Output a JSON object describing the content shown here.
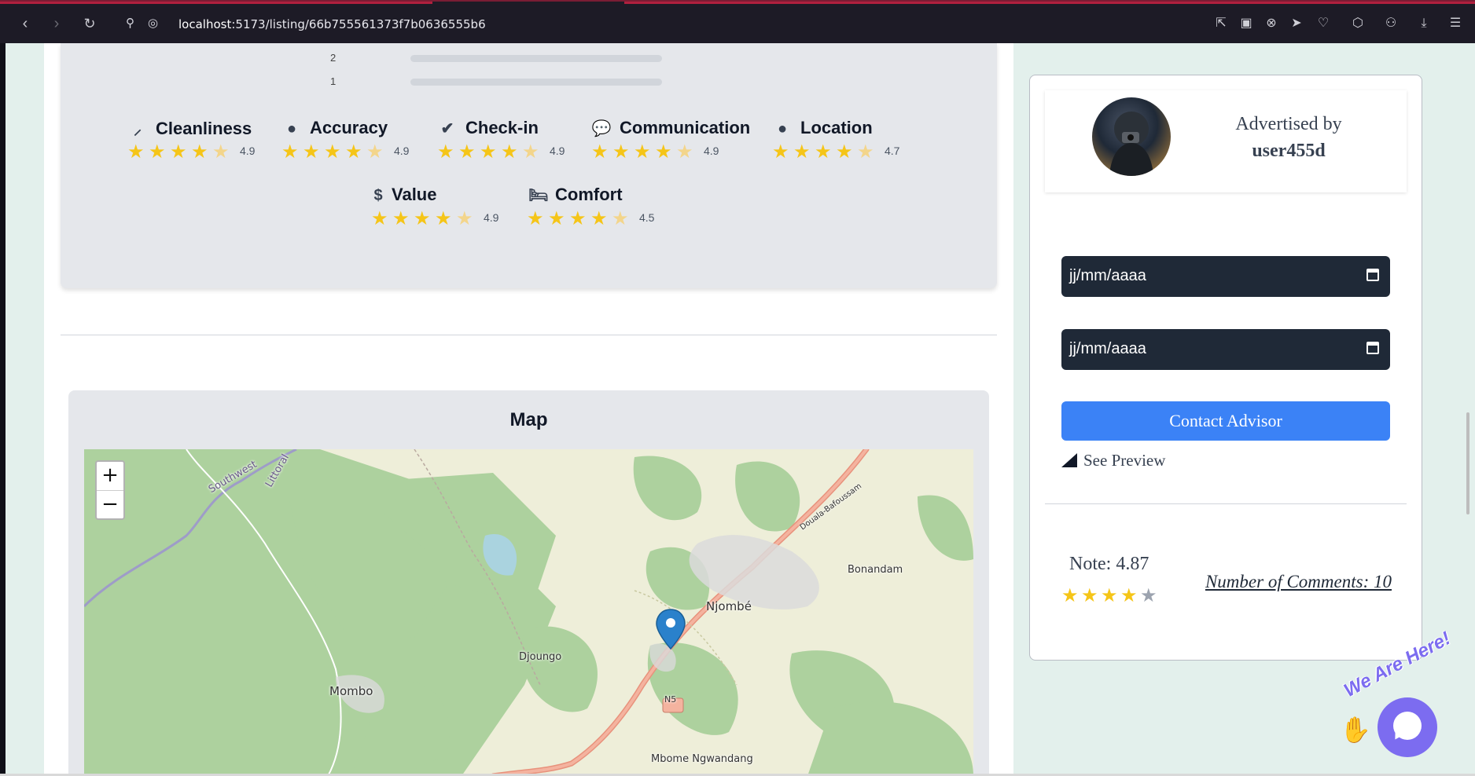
{
  "browser": {
    "url_host": "localhost",
    "url_path": ":5173/listing/66b755561373f7b0636555b6"
  },
  "rating_bars": [
    {
      "label": "2"
    },
    {
      "label": "1"
    }
  ],
  "categories": [
    {
      "name": "Cleanliness",
      "value": "4.9",
      "icon": "broom-icon"
    },
    {
      "name": "Accuracy",
      "value": "4.9",
      "icon": "map-pin-icon"
    },
    {
      "name": "Check-in",
      "value": "4.9",
      "icon": "check-circle-icon"
    },
    {
      "name": "Communication",
      "value": "4.9",
      "icon": "chat-icon"
    },
    {
      "name": "Location",
      "value": "4.7",
      "icon": "map-pin-icon"
    },
    {
      "name": "Value",
      "value": "4.9",
      "icon": "dollar-icon"
    },
    {
      "name": "Comfort",
      "value": "4.5",
      "icon": "bed-icon"
    }
  ],
  "map": {
    "title": "Map",
    "zoom_in": "+",
    "zoom_out": "−",
    "labels": {
      "southwest": "Southwest",
      "littoral": "Littoral",
      "njombe": "Njombé",
      "bonandam": "Bonandam",
      "djoungo": "Djoungo",
      "mombo": "Mombo",
      "n5": "N5",
      "mbome": "Mbome Ngwandang",
      "douala": "Douala-Bafoussam"
    }
  },
  "sidebar": {
    "advertised_by": "Advertised by",
    "username": "user455d",
    "date1_placeholder": "jj/mm/aaaa",
    "date2_placeholder": "jj/mm/aaaa",
    "contact_label": "Contact Advisor",
    "preview_label": "See Preview",
    "note": "Note: 4.87",
    "note_rating": 4.87,
    "comments": "Number of Comments: 10"
  },
  "chat": {
    "label": "We Are Here!"
  },
  "colors": {
    "star": "#f5c518",
    "primary": "#3b82f6",
    "input_bg": "#1f2937",
    "chat": "#7c6cf0"
  }
}
